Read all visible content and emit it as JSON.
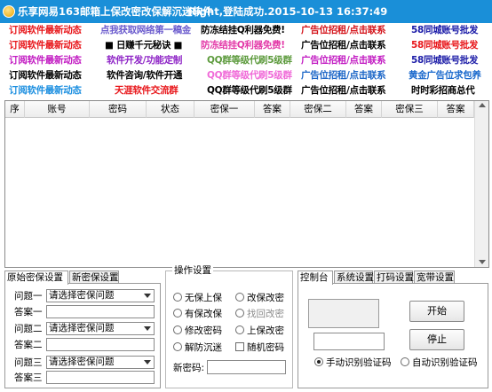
{
  "window": {
    "title": "乐享网易163邮箱上保改密改保解沉迷软件",
    "status": "Right,登陆成功.2015-10-13 16:37:49"
  },
  "ads": [
    [
      {
        "text": "订阅软件最新动态",
        "color": "#e8161a"
      },
      {
        "text": "点我获取网络第一稿金",
        "color": "#6a5acd"
      },
      {
        "text": "防冻结挂Q利器免费!",
        "color": "#000000"
      },
      {
        "text": "广告位招租/点击联系",
        "color": "#d4141b"
      },
      {
        "text": "58同城账号批发",
        "color": "#1a1aa8"
      }
    ],
    [
      {
        "text": "订阅软件最新动态",
        "color": "#e8161a"
      },
      {
        "text": "■ 日赚千元秘诀 ■",
        "color": "#000000"
      },
      {
        "text": "防冻结挂Q利器免费!",
        "color": "#e33aa8"
      },
      {
        "text": "广告位招租/点击联系",
        "color": "#000000"
      },
      {
        "text": "58同城账号批发",
        "color": "#e8161a"
      }
    ],
    [
      {
        "text": "订阅软件最新动态",
        "color": "#c21bc2"
      },
      {
        "text": "软件开发/功能定制",
        "color": "#8e24c6"
      },
      {
        "text": "QQ群等级代刷5级群",
        "color": "#5c9a3c"
      },
      {
        "text": "广告位招租/点击联系",
        "color": "#c21bc2"
      },
      {
        "text": "58同城账号批发",
        "color": "#1e1ea8"
      }
    ],
    [
      {
        "text": "订阅软件最新动态",
        "color": "#000000"
      },
      {
        "text": "软件咨询/软件开通",
        "color": "#000000"
      },
      {
        "text": "QQ群等级代刷5级群",
        "color": "#f06ad8"
      },
      {
        "text": "广告位招租/点击联系",
        "color": "#1c66c7"
      },
      {
        "text": "黄金广告位求包养",
        "color": "#1c6acd"
      }
    ],
    [
      {
        "text": "订阅软件最新动态",
        "color": "#1c8fe0"
      },
      {
        "text": "天涯软件交流群",
        "color": "#e8161a"
      },
      {
        "text": "QQ群等级代刷5级群",
        "color": "#000000"
      },
      {
        "text": "广告位招租/点击联系",
        "color": "#000000"
      },
      {
        "text": "时时彩招商总代",
        "color": "#000000"
      }
    ]
  ],
  "grid": {
    "columns": [
      "序",
      "账号",
      "密码",
      "状态",
      "密保一",
      "答案",
      "密保二",
      "答案",
      "密保三",
      "答案"
    ]
  },
  "left_panel": {
    "tabs": [
      "原始密保设置",
      "新密保设置"
    ],
    "rows": [
      {
        "label": "问题一",
        "combo": "请选择密保问题"
      },
      {
        "label": "答案一"
      },
      {
        "label": "问题二",
        "combo": "请选择密保问题"
      },
      {
        "label": "答案二"
      },
      {
        "label": "问题三",
        "combo": "请选择密保问题"
      },
      {
        "label": "答案三"
      }
    ]
  },
  "operations": {
    "title": "操作设置",
    "options": [
      {
        "label": "无保上保",
        "kind": "radio"
      },
      {
        "label": "改保改密",
        "kind": "radio"
      },
      {
        "label": "有保改保",
        "kind": "radio"
      },
      {
        "label": "找回改密",
        "kind": "radio",
        "disabled": true
      },
      {
        "label": "修改密码",
        "kind": "radio"
      },
      {
        "label": "上保改密",
        "kind": "radio"
      },
      {
        "label": "解防沉迷",
        "kind": "radio"
      },
      {
        "label": "随机密码",
        "kind": "checkbox"
      }
    ],
    "new_password_label": "新密码:"
  },
  "control": {
    "tabs": [
      "控制台",
      "系统设置",
      "打码设置",
      "宽带设置"
    ],
    "start_label": "开始",
    "stop_label": "停止",
    "manual_label": "手动识别验证码",
    "auto_label": "自动识别验证码"
  }
}
